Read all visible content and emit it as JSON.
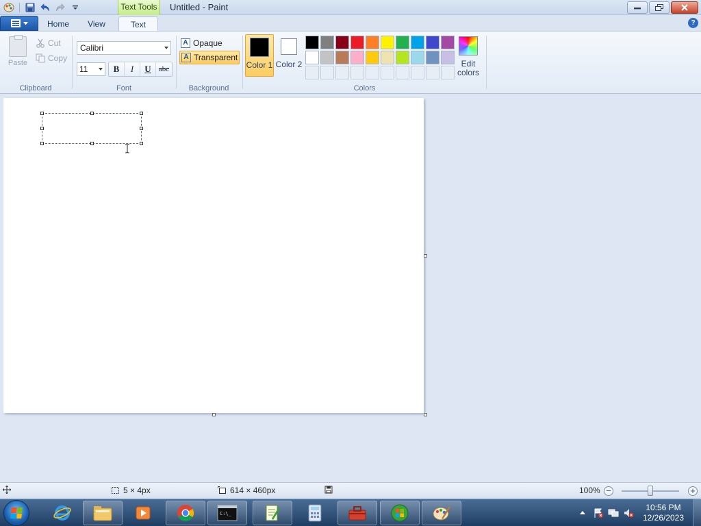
{
  "window": {
    "title": "Untitled - Paint",
    "context_tab": "Text Tools",
    "buttons": {
      "minimize": "minimize",
      "maximize": "restore",
      "close": "close"
    }
  },
  "quick_access": [
    "save-icon",
    "undo-icon",
    "redo-icon",
    "customize-icon"
  ],
  "tabs": [
    {
      "label": "Home",
      "active": false
    },
    {
      "label": "View",
      "active": false
    },
    {
      "label": "Text",
      "active": true
    }
  ],
  "ribbon": {
    "clipboard": {
      "label": "Clipboard",
      "paste": "Paste",
      "cut": "Cut",
      "copy": "Copy"
    },
    "font": {
      "label": "Font",
      "family": "Calibri",
      "size": "11",
      "bold": "B",
      "italic": "I",
      "underline": "U",
      "strike": "abc"
    },
    "background": {
      "label": "Background",
      "opaque": "Opaque",
      "transparent": "Transparent",
      "selected": "transparent"
    },
    "colors": {
      "label": "Colors",
      "color1_label": "Color 1",
      "color2_label": "Color 2",
      "color1": "#000000",
      "color2": "#ffffff",
      "edit_label": "Edit colors",
      "palette_row1": [
        "#000000",
        "#7f7f7f",
        "#880015",
        "#ed1c24",
        "#ff7f27",
        "#fff200",
        "#22b14c",
        "#00a2e8",
        "#3f48cc",
        "#a349a4"
      ],
      "palette_row2": [
        "#ffffff",
        "#c3c3c3",
        "#b97a57",
        "#ffaec9",
        "#ffc90e",
        "#efe4b0",
        "#b5e61d",
        "#99d9ea",
        "#7092be",
        "#c8bfe7"
      ],
      "palette_row3_empty": 10
    }
  },
  "canvas": {
    "textbox_lines": [
      "",
      ""
    ]
  },
  "status": {
    "selection_size": "5 × 4px",
    "canvas_size": "614 × 460px",
    "zoom": "100%",
    "zoom_fraction": 0.5
  },
  "taskbar": {
    "pinned": [
      "internet-explorer-icon",
      "file-explorer-icon",
      "media-player-icon",
      "chrome-icon",
      "command-prompt-icon",
      "notepad-icon",
      "calculator-icon",
      "toolbox-icon",
      "windows-media-center-icon",
      "paint-icon"
    ],
    "clock_time": "10:56 PM",
    "clock_date": "12/26/2023"
  }
}
